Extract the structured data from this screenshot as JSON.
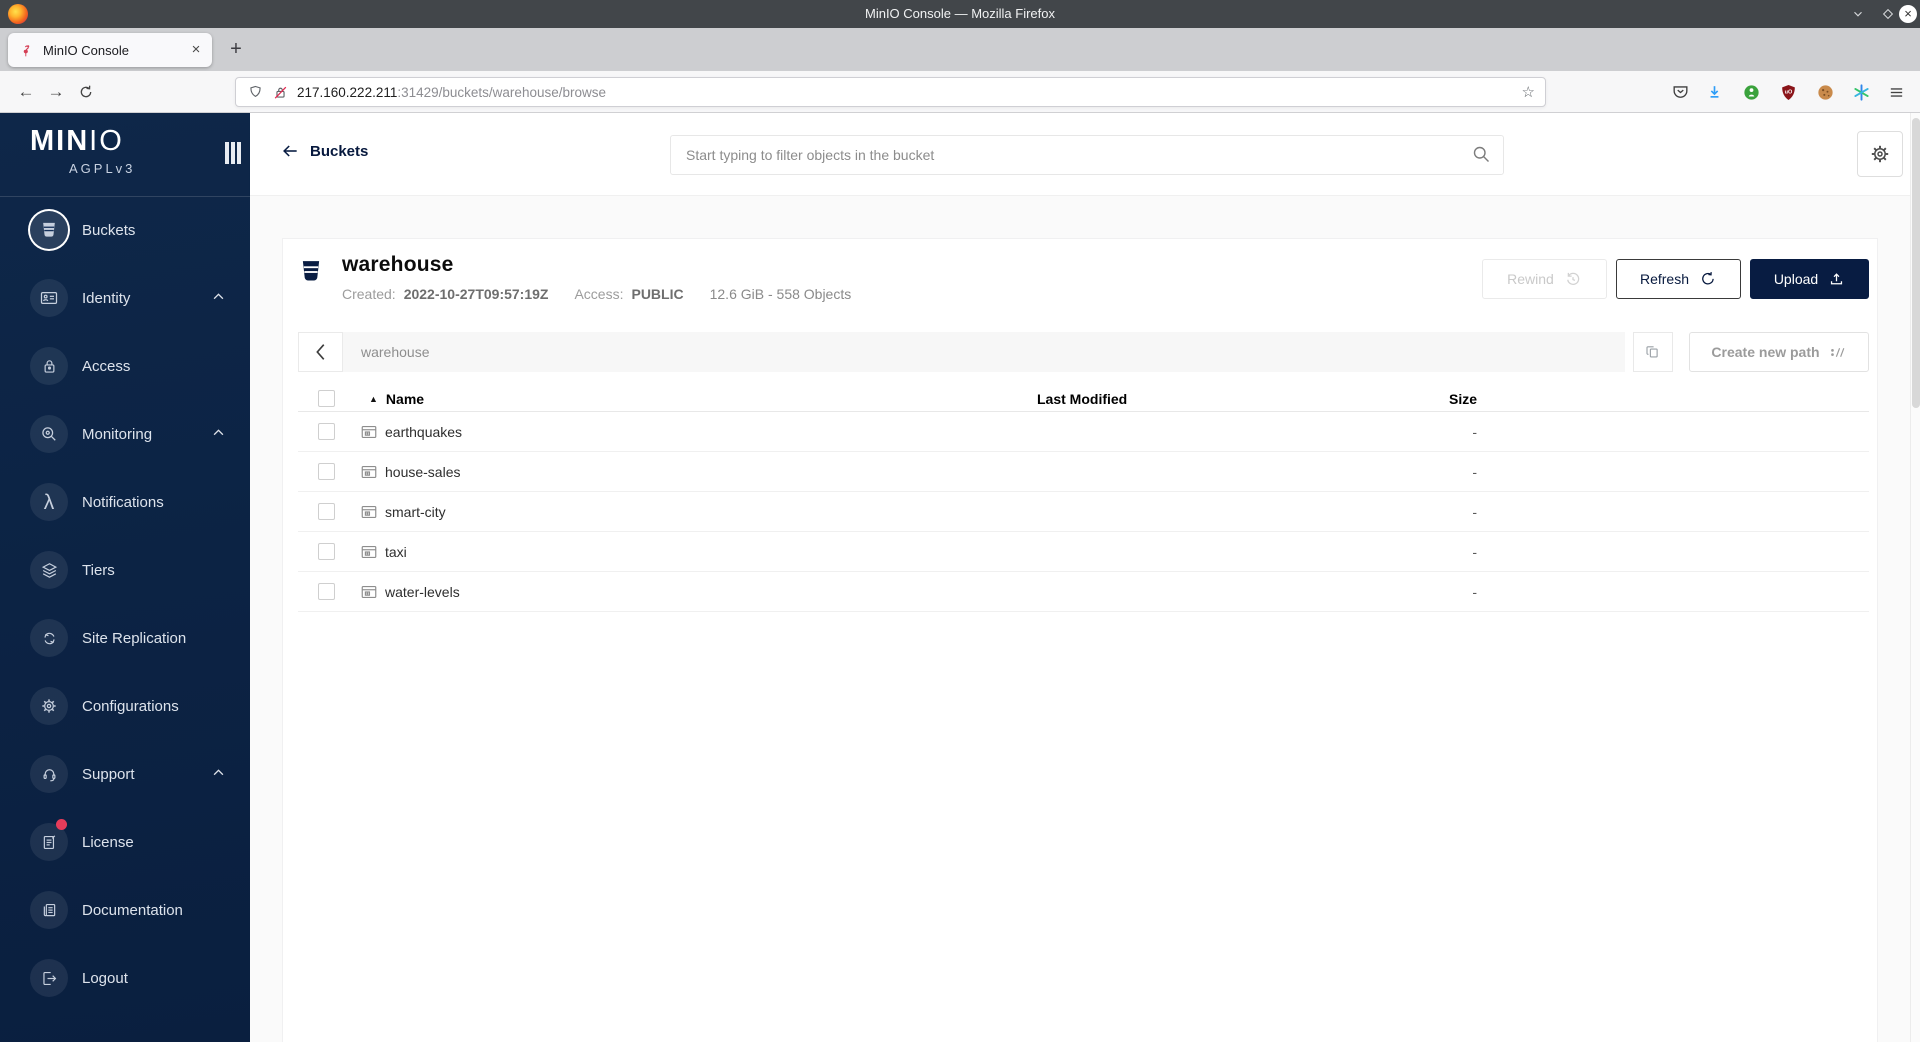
{
  "window": {
    "title": "MinIO Console — Mozilla Firefox",
    "controls": [
      "minimize-icon",
      "maximize-icon",
      "close-icon"
    ]
  },
  "browser": {
    "tab_title": "MinIO Console",
    "new_tab_glyph": "+",
    "close_tab_glyph": "×",
    "url_host": "217.160.222.211",
    "url_rest": ":31429/buckets/warehouse/browse",
    "toolbar_icons": [
      "pocket-icon",
      "download-icon",
      "extension-green-icon",
      "ublock-icon",
      "cookie-icon",
      "consent-icon",
      "menu-icon"
    ]
  },
  "sidebar": {
    "brand_bold": "MIN",
    "brand_light": "IO",
    "license_tag": "AGPLv3",
    "items": [
      {
        "label": "Buckets",
        "icon": "bucket-icon",
        "selected": true
      },
      {
        "label": "Identity",
        "icon": "identity-icon",
        "chevron": true
      },
      {
        "label": "Access",
        "icon": "lock-icon"
      },
      {
        "label": "Monitoring",
        "icon": "monitoring-icon",
        "chevron": true
      },
      {
        "label": "Notifications",
        "icon": "lambda-icon"
      },
      {
        "label": "Tiers",
        "icon": "layers-icon"
      },
      {
        "label": "Site Replication",
        "icon": "replication-icon"
      },
      {
        "label": "Configurations",
        "icon": "gear-icon"
      },
      {
        "label": "Support",
        "icon": "support-icon",
        "chevron": true
      },
      {
        "label": "License",
        "icon": "license-icon",
        "badge": true
      },
      {
        "label": "Documentation",
        "icon": "documentation-icon"
      },
      {
        "label": "Logout",
        "icon": "logout-icon"
      }
    ]
  },
  "header": {
    "back_label": "Buckets",
    "search_placeholder": "Start typing to filter objects in the bucket"
  },
  "bucket": {
    "name": "warehouse",
    "created_label": "Created:",
    "created_value": "2022-10-27T09:57:19Z",
    "access_label": "Access:",
    "access_value": "PUBLIC",
    "usage": "12.6 GiB - 558 Objects",
    "rewind_label": "Rewind",
    "refresh_label": "Refresh",
    "upload_label": "Upload"
  },
  "browse": {
    "path": "warehouse",
    "create_path_label": "Create new path",
    "columns": {
      "name": "Name",
      "last_modified": "Last Modified",
      "size": "Size"
    },
    "sort_glyph": "▲",
    "rows": [
      {
        "name": "earthquakes",
        "last_modified": "",
        "size": "-"
      },
      {
        "name": "house-sales",
        "last_modified": "",
        "size": "-"
      },
      {
        "name": "smart-city",
        "last_modified": "",
        "size": "-"
      },
      {
        "name": "taxi",
        "last_modified": "",
        "size": "-"
      },
      {
        "name": "water-levels",
        "last_modified": "",
        "size": "-"
      }
    ]
  },
  "colors": {
    "accent_navy": "#081C42",
    "sidebar_navy": "#0B2243",
    "badge_red": "#E73C5A",
    "download_blue": "#2E9DF7"
  }
}
